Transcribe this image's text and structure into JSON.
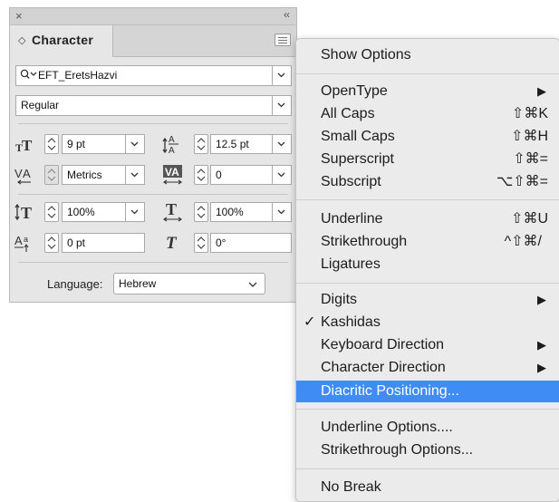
{
  "panel": {
    "close_glyph": "×",
    "collapse_glyph": "‹‹",
    "tab_arrows": "◇",
    "tab_title": "Character",
    "font_family": "EFT_EretsHazvi",
    "font_style": "Regular",
    "font_size": "9 pt",
    "leading": "12.5 pt",
    "kerning": "Metrics",
    "tracking": "0",
    "vertical_scale": "100%",
    "horizontal_scale": "100%",
    "baseline_shift": "0 pt",
    "skew": "0°",
    "language_label": "Language:",
    "language": "Hebrew"
  },
  "menu": {
    "items": [
      {
        "label": "Show Options",
        "shortcut": ""
      },
      {
        "label": "OpenType",
        "shortcut": "▶"
      },
      {
        "label": "All Caps",
        "shortcut": "⇧⌘K"
      },
      {
        "label": "Small Caps",
        "shortcut": "⇧⌘H"
      },
      {
        "label": "Superscript",
        "shortcut": "⇧⌘="
      },
      {
        "label": "Subscript",
        "shortcut": "⌥⇧⌘="
      },
      {
        "label": "Underline",
        "shortcut": "⇧⌘U"
      },
      {
        "label": "Strikethrough",
        "shortcut": "^⇧⌘/"
      },
      {
        "label": "Ligatures",
        "shortcut": ""
      },
      {
        "label": "Digits",
        "shortcut": "▶"
      },
      {
        "label": "Kashidas",
        "shortcut": "",
        "checked": true,
        "check_glyph": "✓"
      },
      {
        "label": "Keyboard Direction",
        "shortcut": "▶"
      },
      {
        "label": "Character Direction",
        "shortcut": "▶"
      },
      {
        "label": "Diacritic Positioning...",
        "shortcut": "",
        "highlighted": true
      },
      {
        "label": "Underline Options....",
        "shortcut": ""
      },
      {
        "label": "Strikethrough Options...",
        "shortcut": ""
      },
      {
        "label": "No Break",
        "shortcut": ""
      }
    ]
  },
  "colors": {
    "panel_bg": "#e6e6e6",
    "menu_bg": "#ebebeb",
    "highlight": "#3f8cf5"
  }
}
